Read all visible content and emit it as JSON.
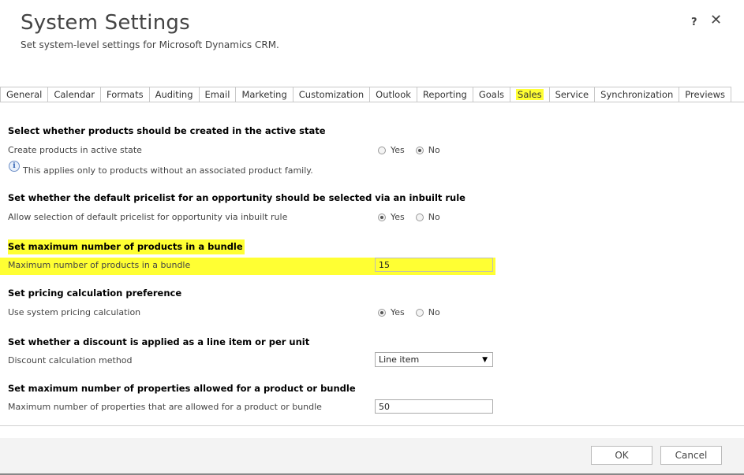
{
  "header": {
    "title": "System Settings",
    "subtitle": "Set system-level settings for Microsoft Dynamics CRM.",
    "help_label": "?",
    "close_label": "✕"
  },
  "tabs": [
    {
      "label": "General"
    },
    {
      "label": "Calendar"
    },
    {
      "label": "Formats"
    },
    {
      "label": "Auditing"
    },
    {
      "label": "Email"
    },
    {
      "label": "Marketing"
    },
    {
      "label": "Customization"
    },
    {
      "label": "Outlook"
    },
    {
      "label": "Reporting"
    },
    {
      "label": "Goals"
    },
    {
      "label": "Sales",
      "active": true
    },
    {
      "label": "Service"
    },
    {
      "label": "Synchronization"
    },
    {
      "label": "Previews"
    }
  ],
  "sections": {
    "active_state": {
      "heading": "Select whether products should be created in the active state",
      "label": "Create products in active state",
      "yes": "Yes",
      "no": "No",
      "selected": "No",
      "note": "This applies only to products without an associated product family."
    },
    "pricelist": {
      "heading": "Set whether the default pricelist for an opportunity should be selected via an inbuilt rule",
      "label": "Allow selection of default pricelist for opportunity via inbuilt rule",
      "yes": "Yes",
      "no": "No",
      "selected": "Yes"
    },
    "bundle": {
      "heading": "Set maximum number of products in a bundle",
      "label": "Maximum number of products in a bundle",
      "value": "15"
    },
    "pricing": {
      "heading": "Set pricing calculation preference",
      "label": "Use system pricing calculation",
      "yes": "Yes",
      "no": "No",
      "selected": "Yes"
    },
    "discount": {
      "heading": "Set whether a discount is applied as a line item or per unit",
      "label": "Discount calculation method",
      "value": "Line item"
    },
    "properties": {
      "heading": "Set maximum number of properties allowed for a product or bundle",
      "label": "Maximum number of properties that are allowed for a product or bundle",
      "value": "50"
    }
  },
  "footer": {
    "ok_label": "OK",
    "cancel_label": "Cancel"
  },
  "colors": {
    "highlight": "#ffff33",
    "text": "#444444"
  }
}
